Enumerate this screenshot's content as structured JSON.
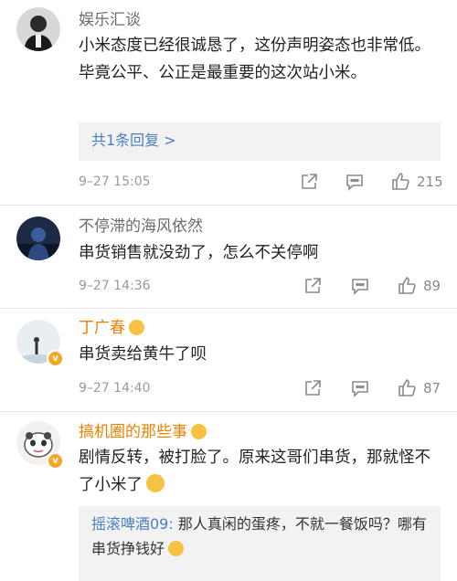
{
  "comments": [
    {
      "username": "娱乐汇谈",
      "text": "小米态度已经很诚恳了，这份声明姿态也非常低。毕竟公平、公正是最重要的这次站小米。",
      "reply_link": "共1条回复 >",
      "time": "9–27 15:05",
      "likes": "215"
    },
    {
      "username": "不停滞的海风依然",
      "text": "串货销售就没劲了，怎么不关停啊",
      "time": "9–27 14:36",
      "likes": "89"
    },
    {
      "username": "丁广春",
      "text": "串货卖给黄牛了呗",
      "time": "9–27 14:40",
      "likes": "87"
    },
    {
      "username": "搞机圈的那些事",
      "text": "剧情反转，被打脸了。原来这哥们串货，那就怪不了小米了",
      "reply": {
        "name": "摇滚啤酒09:",
        "text": " 那人真闲的蛋疼，不就一餐饭吗？哪有串货挣钱好"
      }
    }
  ],
  "icons": {
    "share": "share-icon",
    "comment": "comment-icon",
    "like": "thumbs-up-icon",
    "verified": "verified-badge-icon"
  },
  "colors": {
    "link": "#4a7fc1",
    "vip_name": "#ee8000",
    "badge": "#f5a623",
    "reply_bg": "#f2f2f2"
  }
}
